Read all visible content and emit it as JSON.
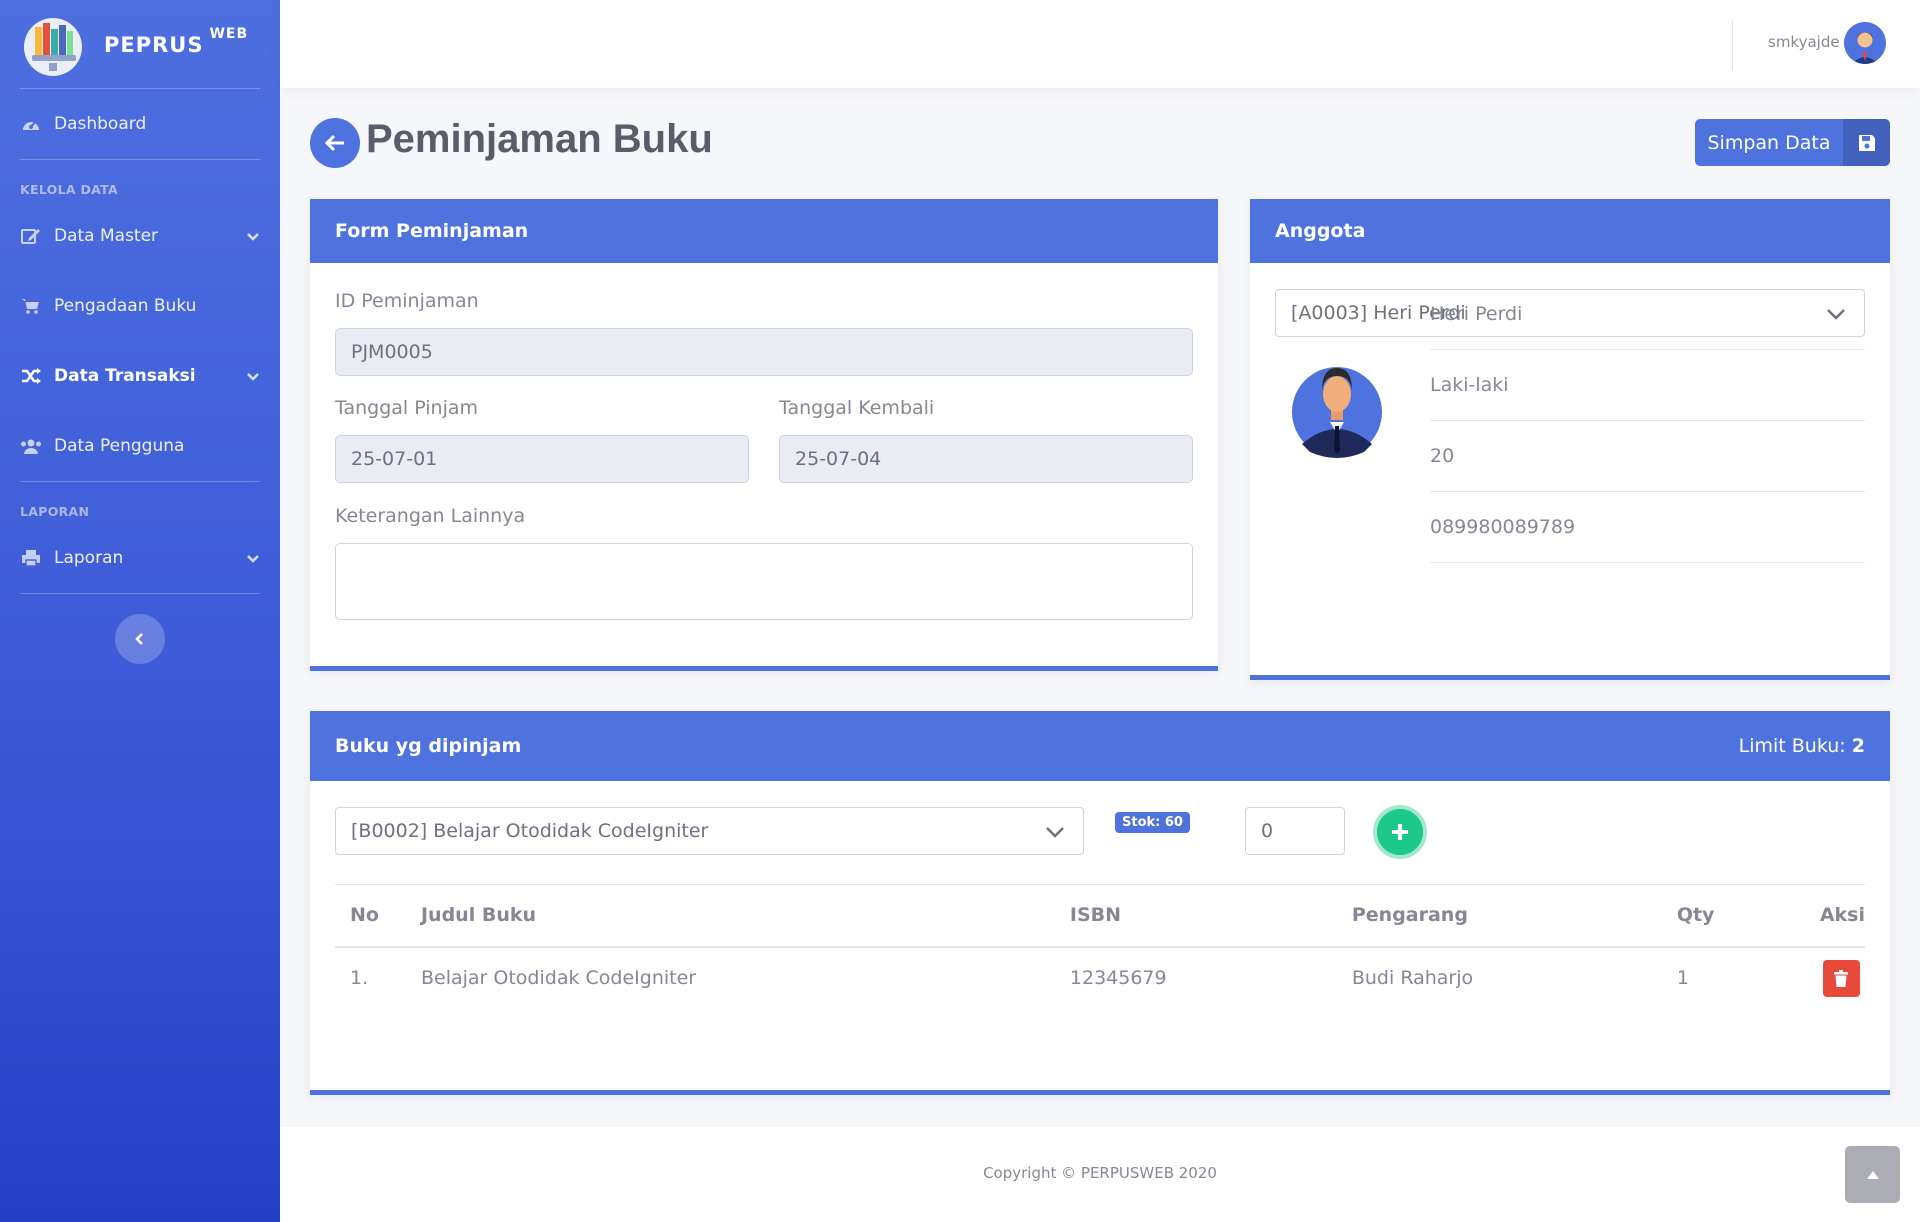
{
  "brand": {
    "name": "PEPRUS",
    "sup": "WEB"
  },
  "sidebar": {
    "dashboard": "Dashboard",
    "section_kelola": "KELOLA DATA",
    "data_master": "Data Master",
    "pengadaan": "Pengadaan Buku",
    "transaksi": "Data Transaksi",
    "pengguna": "Data Pengguna",
    "section_laporan": "LAPORAN",
    "laporan": "Laporan"
  },
  "topbar": {
    "username": "smkyajde"
  },
  "page": {
    "title": "Peminjaman Buku",
    "save_label": "Simpan Data"
  },
  "form": {
    "header": "Form Peminjaman",
    "id_label": "ID Peminjaman",
    "id_value": "PJM0005",
    "tgl_pinjam_label": "Tanggal Pinjam",
    "tgl_pinjam_value": "25-07-01",
    "tgl_kembali_label": "Tanggal Kembali",
    "tgl_kembali_value": "25-07-04",
    "keterangan_label": "Keterangan Lainnya",
    "keterangan_value": ""
  },
  "anggota": {
    "header": "Anggota",
    "selected": "[A0003] Heri Perdi",
    "name": "Heri Perdi",
    "gender": "Laki-laki",
    "age": "20",
    "phone": "089980089789"
  },
  "buku": {
    "header": "Buku yg dipinjam",
    "limit_label": "Limit Buku:",
    "limit_value": "2",
    "selected_book": "[B0002] Belajar Otodidak CodeIgniter",
    "stok": "Stok: 60",
    "qty_value": "0",
    "columns": [
      "No",
      "Judul Buku",
      "ISBN",
      "Pengarang",
      "Qty",
      "Aksi"
    ],
    "rows": [
      {
        "no": "1.",
        "judul": "Belajar Otodidak CodeIgniter",
        "isbn": "12345679",
        "pengarang": "Budi Raharjo",
        "qty": "1"
      }
    ]
  },
  "footer": {
    "copyright": "Copyright © PERPUSWEB 2020"
  },
  "colors": {
    "primary": "#4e73df",
    "success": "#1cc88a",
    "danger": "#e74a3b"
  }
}
